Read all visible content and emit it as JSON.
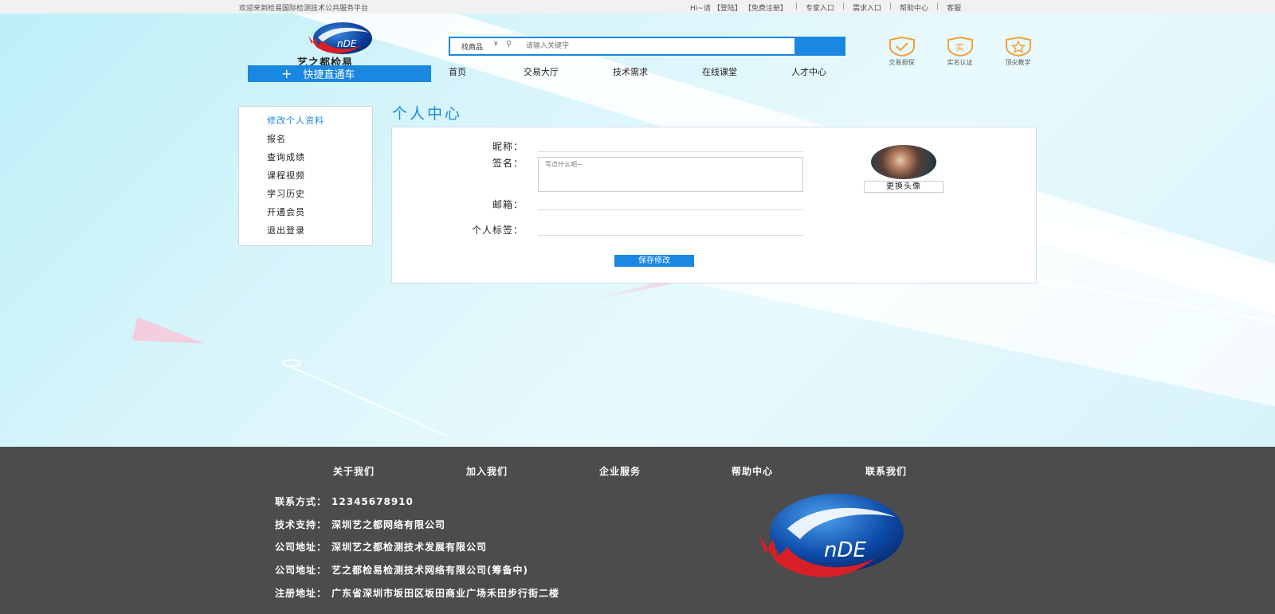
{
  "topbar": {
    "welcome": "欢迎来到检易国际检测技术公共服务平台",
    "greeting": "Hi~请",
    "login": "【登陆】",
    "register": "【免费注册】",
    "links": [
      "专家入口",
      "需求入口",
      "帮助中心",
      "客服"
    ]
  },
  "header": {
    "logo_text": "艺之都检易",
    "logo_mark": "nDE",
    "quick_label": "快捷直通车",
    "search": {
      "category": "找商品",
      "placeholder": "请输入关键字"
    },
    "nav": [
      "首页",
      "交易大厅",
      "技术需求",
      "在线课堂",
      "人才中心"
    ],
    "badges": [
      {
        "label": "交易担保",
        "icon": "check-shield-icon"
      },
      {
        "label": "实名认证",
        "icon": "verified-shield-icon",
        "glyph": "实"
      },
      {
        "label": "顶尖教学",
        "icon": "star-shield-icon"
      }
    ]
  },
  "sidebar": {
    "items": [
      "修改个人资料",
      "报名",
      "查询成绩",
      "课程视频",
      "学习历史",
      "开通会员",
      "退出登录"
    ]
  },
  "main": {
    "title": "个人中心",
    "form": {
      "nickname_label": "昵称：",
      "nickname_value": "",
      "signature_label": "签名：",
      "signature_placeholder": "写点什么吧~",
      "email_label": "邮箱：",
      "email_value": "",
      "tags_label": "个人标签：",
      "tags_value": "",
      "save_label": "保存修改"
    },
    "avatar": {
      "change_label": "更换头像"
    }
  },
  "footer": {
    "nav": [
      "关于我们",
      "加入我们",
      "企业服务",
      "帮助中心",
      "联系我们"
    ],
    "info": [
      {
        "label": "联系方式：",
        "value": "12345678910"
      },
      {
        "label": "技术支持：",
        "value": "深圳艺之都网络有限公司"
      },
      {
        "label": "公司地址：",
        "value": "深圳艺之都检测技术发展有限公司"
      },
      {
        "label": "公司地址：",
        "value": "艺之都检易检测技术网络有限公司(筹备中)"
      },
      {
        "label": "注册地址：",
        "value": "广东省深圳市坂田区坂田商业广场禾田步行街二楼"
      }
    ],
    "logo_mark": "nDE"
  },
  "colors": {
    "accent": "#1a87e0",
    "badge": "#f0a23a",
    "footer_bg": "#4c4c4c"
  }
}
